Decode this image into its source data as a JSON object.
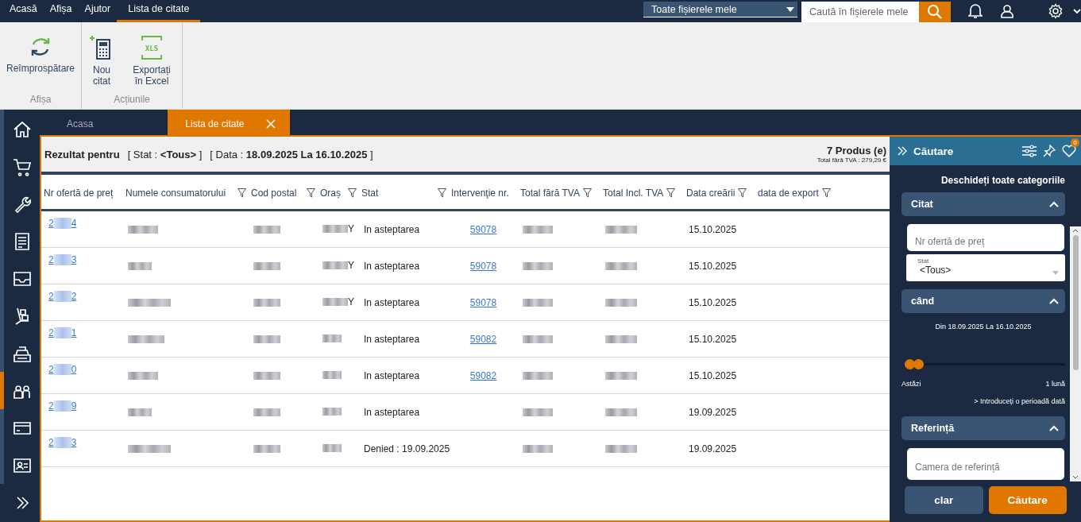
{
  "menu": [
    {
      "label": "Acasă",
      "selected": false
    },
    {
      "label": "Afișa",
      "selected": false
    },
    {
      "label": "Ajutor",
      "selected": false
    },
    {
      "label": "Lista de citate",
      "selected": true
    }
  ],
  "file_scope": {
    "value": "Toate fișierele mele"
  },
  "search": {
    "placeholder": "Caută în fișierele mele"
  },
  "ribbon": [
    {
      "label": "Afișa",
      "buttons": [
        {
          "label": "Reîmprospătare"
        }
      ]
    },
    {
      "label": "Acțiunile",
      "buttons": [
        {
          "label": "Nou citat"
        },
        {
          "label": "Exportați în Excel",
          "icon_text": "XLS"
        }
      ]
    }
  ],
  "sidebar": {
    "items": [
      {
        "selected": false
      },
      {
        "selected": false
      },
      {
        "selected": false
      },
      {
        "selected": false
      },
      {
        "selected": false
      },
      {
        "selected": false
      },
      {
        "selected": false
      },
      {
        "selected": true
      },
      {
        "selected": false
      },
      {
        "selected": false
      }
    ]
  },
  "tabs": [
    {
      "label": "Acasa",
      "selected": false
    },
    {
      "label": "Lista de citate",
      "selected": true
    }
  ],
  "results": {
    "title": "Rezultat pentru",
    "stat": "[ Stat : **<Tous>** ]",
    "date": "[ Data : **18.09.2025 La 16.10.2025** ]",
    "count": "7 Produs (e)",
    "total": "Total fără TVA : 279,29 €"
  },
  "table": {
    "columns": [
      {
        "label": "Nr ofertă de preț",
        "filter": false
      },
      {
        "label": "Numele consumatorului",
        "filter": true
      },
      {
        "label": "Cod postal",
        "filter": true
      },
      {
        "label": "Oraș",
        "filter": true
      },
      {
        "label": "Stat",
        "filter": true
      },
      {
        "label": "Intervenţie nr.",
        "filter": false
      },
      {
        "label": "Total fără TVA",
        "filter": true
      },
      {
        "label": "Total Incl. TVA",
        "filter": true
      },
      {
        "label": "Data creării",
        "filter": true
      },
      {
        "label": "data de export",
        "filter": true
      }
    ],
    "rows": [
      {
        "quote_start": "2",
        "quote_end": "4",
        "city_end": "Y",
        "stat": "In asteptarea",
        "intervention": "59078",
        "created": "15.10.2025"
      },
      {
        "quote_start": "2",
        "quote_end": "3",
        "city_end": "Y",
        "stat": "In asteptarea",
        "intervention": "59078",
        "created": "15.10.2025"
      },
      {
        "quote_start": "2",
        "quote_end": "2",
        "city_end": "Y",
        "stat": "In asteptarea",
        "intervention": "59078",
        "created": "15.10.2025"
      },
      {
        "quote_start": "2",
        "quote_end": "1",
        "stat": "In asteptarea",
        "intervention": "59082",
        "created": "15.10.2025"
      },
      {
        "quote_start": "2",
        "quote_end": "0",
        "stat": "In asteptarea",
        "intervention": "59082",
        "created": "15.10.2025"
      },
      {
        "quote_start": "2",
        "quote_end": "9",
        "stat": "In asteptarea",
        "created": "19.09.2025"
      },
      {
        "quote_start": "2",
        "quote_end": "3",
        "stat": "Denied : 19.09.2025",
        "created": "19.09.2025"
      }
    ]
  },
  "search_panel": {
    "title": "Căutare",
    "badge": "0",
    "expand_all": "Deschideți toate categoriile",
    "quote_section": {
      "title": "Citat",
      "expanded": true,
      "number_field": {
        "placeholder": "Nr ofertă de preț"
      },
      "stat_select": {
        "label": "Stat",
        "value": "<Tous>"
      }
    },
    "when_section": {
      "title": "când",
      "expanded": true,
      "range": "Din 18.09.2025 La 16.10.2025",
      "slider": {
        "level": 0.12,
        "start_label": "Astăzi",
        "end_label": "1 lună"
      },
      "custom_period": "> Introduceți o perioadă dată"
    },
    "reference_section": {
      "title": "Referință",
      "expanded": true,
      "field": {
        "placeholder": "Camera de referință"
      }
    },
    "buttons": {
      "clear": "clar",
      "search": "Căutare"
    }
  }
}
